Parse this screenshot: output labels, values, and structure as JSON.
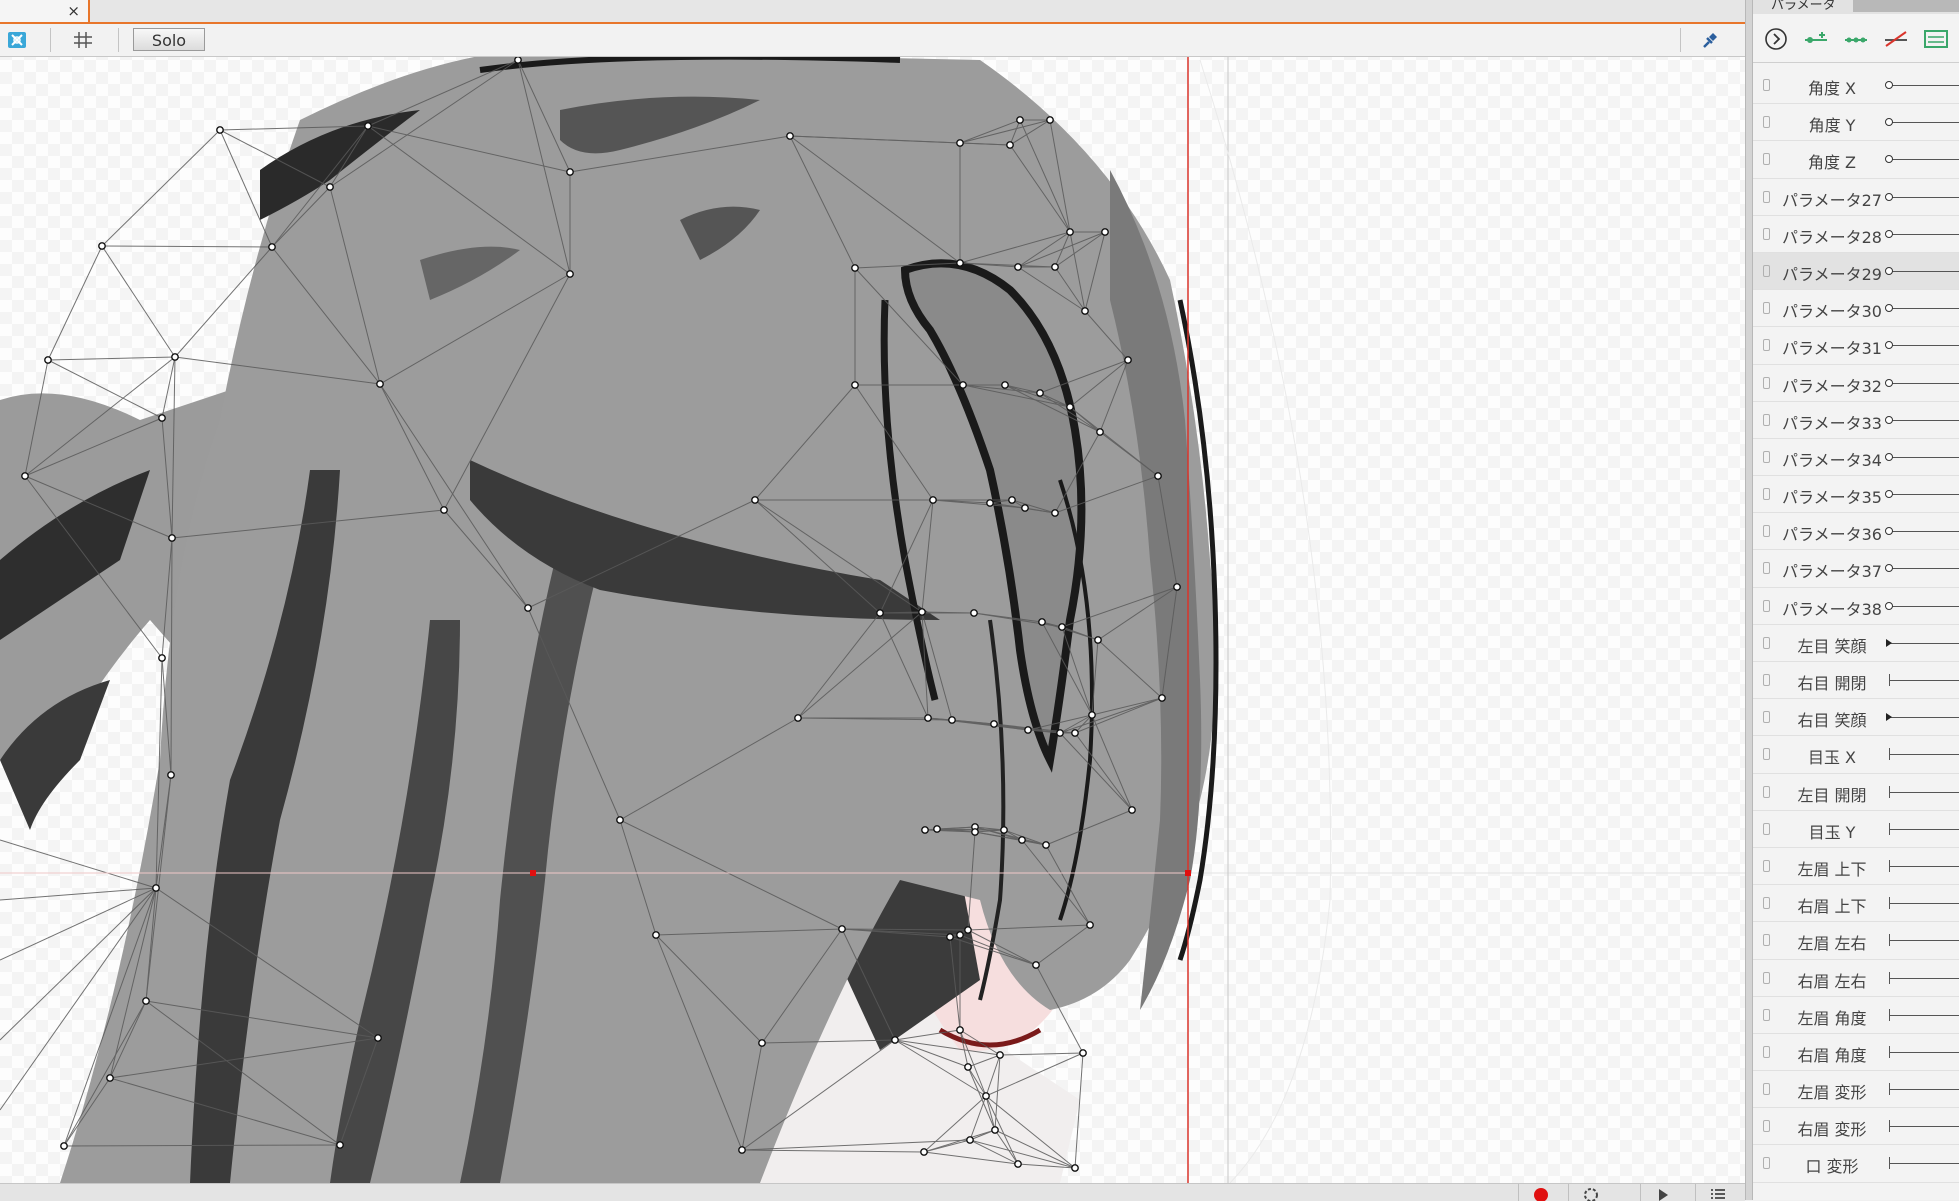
{
  "editor": {
    "tab_close": "×",
    "solo_label": "Solo",
    "toolbar_icons": [
      "deformer-view-icon",
      "grid-icon",
      "pin-icon"
    ]
  },
  "panel": {
    "title": "パラメータ",
    "tools": [
      "play-circle-icon",
      "add-key-icon",
      "add-keys-icon",
      "remove-key-icon",
      "param-view-icon"
    ],
    "selected_index": 5,
    "params": [
      {
        "name": "角度 X",
        "knob": "circle"
      },
      {
        "name": "角度 Y",
        "knob": "circle"
      },
      {
        "name": "角度 Z",
        "knob": "circle"
      },
      {
        "name": "パラメータ27",
        "knob": "circle"
      },
      {
        "name": "パラメータ28",
        "knob": "circle"
      },
      {
        "name": "パラメータ29",
        "knob": "circle"
      },
      {
        "name": "パラメータ30",
        "knob": "circle"
      },
      {
        "name": "パラメータ31",
        "knob": "circle"
      },
      {
        "name": "パラメータ32",
        "knob": "circle"
      },
      {
        "name": "パラメータ33",
        "knob": "circle"
      },
      {
        "name": "パラメータ34",
        "knob": "circle"
      },
      {
        "name": "パラメータ35",
        "knob": "circle"
      },
      {
        "name": "パラメータ36",
        "knob": "circle"
      },
      {
        "name": "パラメータ37",
        "knob": "circle"
      },
      {
        "name": "パラメータ38",
        "knob": "circle"
      },
      {
        "name": "左目 笑顔",
        "knob": "marker"
      },
      {
        "name": "右目 開閉",
        "knob": "tick"
      },
      {
        "name": "右目 笑顔",
        "knob": "marker"
      },
      {
        "name": "目玉 X",
        "knob": "tick"
      },
      {
        "name": "左目 開閉",
        "knob": "tick"
      },
      {
        "name": "目玉 Y",
        "knob": "tick"
      },
      {
        "name": "左眉 上下",
        "knob": "tick"
      },
      {
        "name": "右眉 上下",
        "knob": "tick"
      },
      {
        "name": "左眉 左右",
        "knob": "tick"
      },
      {
        "name": "右眉 左右",
        "knob": "tick"
      },
      {
        "name": "左眉 角度",
        "knob": "tick"
      },
      {
        "name": "右眉 角度",
        "knob": "tick"
      },
      {
        "name": "左眉 変形",
        "knob": "tick"
      },
      {
        "name": "右眉 変形",
        "knob": "tick"
      },
      {
        "name": "口 変形",
        "knob": "tick"
      }
    ]
  },
  "status": {
    "record_color": "#e01010",
    "icons": [
      "record-icon",
      "settings-icon",
      "play-icon",
      "list-icon"
    ]
  },
  "colors": {
    "accent": "#e8762b",
    "guide_line": "#d9342b"
  }
}
